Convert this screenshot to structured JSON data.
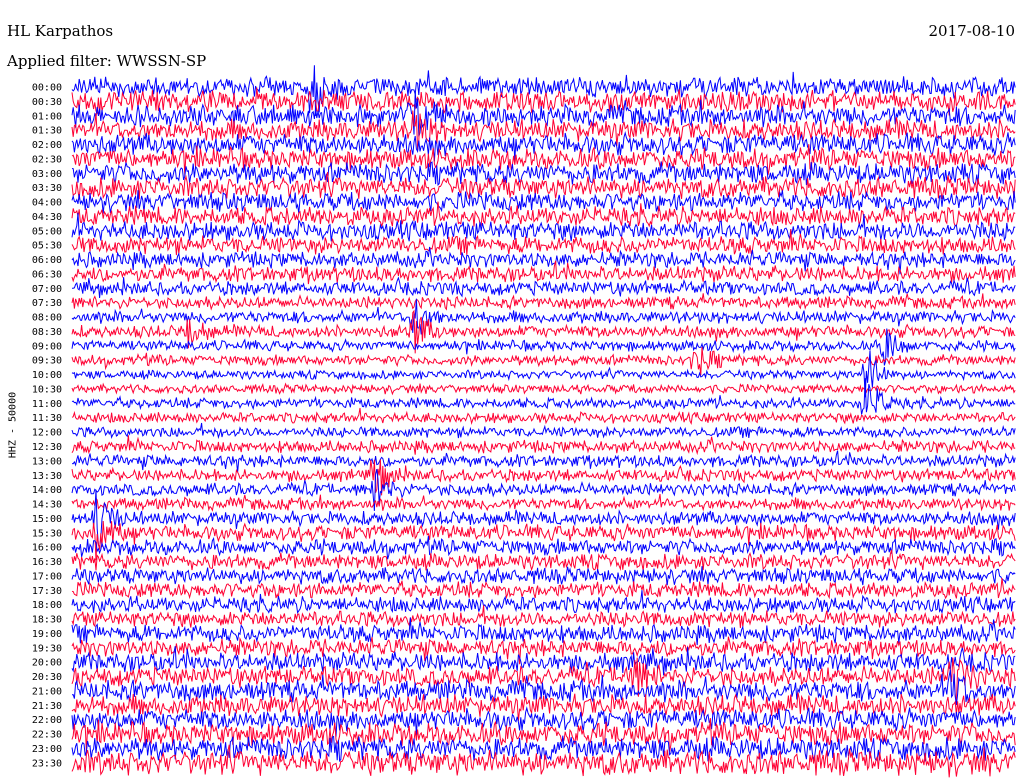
{
  "header": {
    "station": "HL Karpathos",
    "date": "2017-08-10",
    "filter": "Applied filter: WWSSN-SP"
  },
  "chart_data": {
    "type": "line",
    "title": "HL Karpathos",
    "date": "2017-08-10",
    "filter": "Applied filter: WWSSN-SP",
    "ylabel": "HHZ - 50000",
    "row_labels": [
      "00:00",
      "00:30",
      "01:00",
      "01:30",
      "02:00",
      "02:30",
      "03:00",
      "03:30",
      "04:00",
      "04:30",
      "05:00",
      "05:30",
      "06:00",
      "06:30",
      "07:00",
      "07:30",
      "08:00",
      "08:30",
      "09:00",
      "09:30",
      "10:00",
      "10:30",
      "11:00",
      "11:30",
      "12:00",
      "12:30",
      "13:00",
      "13:30",
      "14:00",
      "14:30",
      "15:00",
      "15:30",
      "16:00",
      "16:30",
      "17:00",
      "17:30",
      "18:00",
      "18:30",
      "19:00",
      "19:30",
      "20:00",
      "20:30",
      "21:00",
      "21:30",
      "22:00",
      "22:30",
      "23:00",
      "23:30"
    ],
    "row_noise_level": [
      0.55,
      0.6,
      0.6,
      0.6,
      0.6,
      0.6,
      0.6,
      0.6,
      0.55,
      0.55,
      0.55,
      0.5,
      0.45,
      0.45,
      0.4,
      0.35,
      0.35,
      0.35,
      0.3,
      0.3,
      0.25,
      0.25,
      0.3,
      0.3,
      0.3,
      0.35,
      0.35,
      0.35,
      0.35,
      0.35,
      0.4,
      0.45,
      0.45,
      0.45,
      0.45,
      0.45,
      0.45,
      0.45,
      0.5,
      0.5,
      0.55,
      0.55,
      0.6,
      0.6,
      0.6,
      0.65,
      0.65,
      0.7
    ],
    "events": [
      {
        "row": 0,
        "x_fraction": 0.255,
        "amplitude": 2.2
      },
      {
        "row": 2,
        "x_fraction": 0.36,
        "amplitude": 1.8
      },
      {
        "row": 3,
        "x_fraction": 0.36,
        "amplitude": 1.5
      },
      {
        "row": 16,
        "x_fraction": 0.36,
        "amplitude": 1.8
      },
      {
        "row": 17,
        "x_fraction": 0.36,
        "amplitude": 1.6
      },
      {
        "row": 17,
        "x_fraction": 0.12,
        "amplitude": 1.2
      },
      {
        "row": 18,
        "x_fraction": 0.86,
        "amplitude": 1.4
      },
      {
        "row": 19,
        "x_fraction": 0.66,
        "amplitude": 1.2
      },
      {
        "row": 20,
        "x_fraction": 0.84,
        "amplitude": 2.2
      },
      {
        "row": 22,
        "x_fraction": 0.84,
        "amplitude": 2.0
      },
      {
        "row": 27,
        "x_fraction": 0.32,
        "amplitude": 1.6
      },
      {
        "row": 28,
        "x_fraction": 0.32,
        "amplitude": 1.4
      },
      {
        "row": 30,
        "x_fraction": 0.025,
        "amplitude": 2.2
      },
      {
        "row": 31,
        "x_fraction": 0.025,
        "amplitude": 2.0
      },
      {
        "row": 41,
        "x_fraction": 0.59,
        "amplitude": 1.8
      },
      {
        "row": 41,
        "x_fraction": 0.93,
        "amplitude": 2.2
      },
      {
        "row": 42,
        "x_fraction": 0.93,
        "amplitude": 1.8
      }
    ],
    "series_colors": [
      "#0000ff",
      "#ff0033"
    ],
    "grid": false
  }
}
